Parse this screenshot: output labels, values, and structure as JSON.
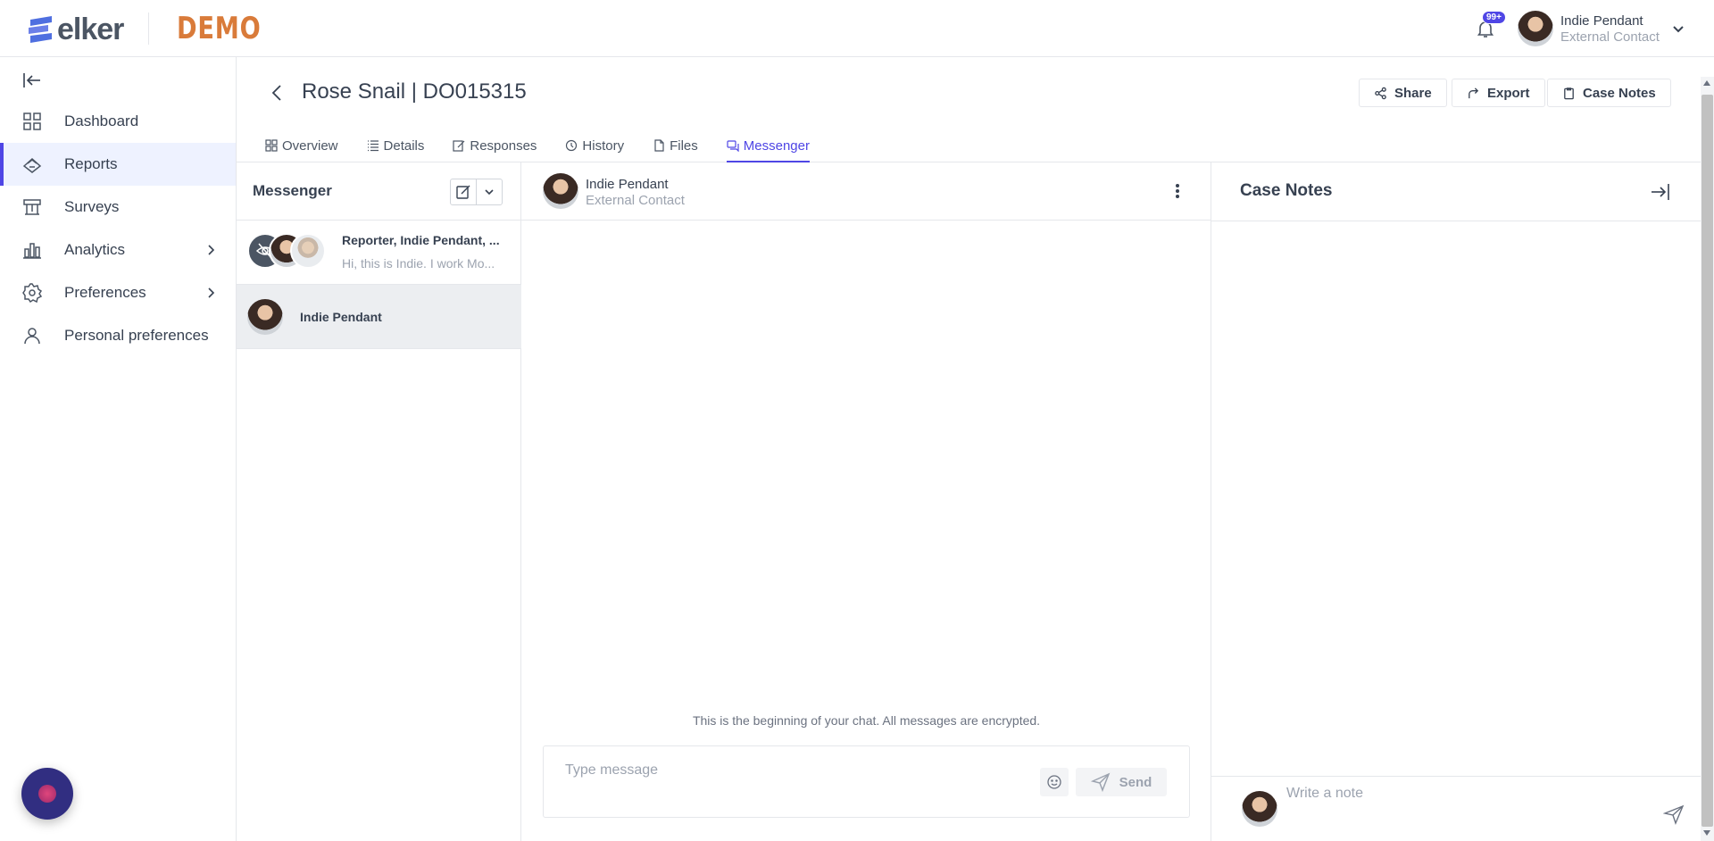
{
  "app": {
    "logo_text": "elker",
    "environment_label": "DEMO",
    "accent_color": "#4f46e5",
    "demo_color": "#d97b3a"
  },
  "topbar": {
    "notification_count": "99+",
    "user_name": "Indie Pendant",
    "user_role": "External Contact"
  },
  "sidebar": {
    "items": [
      {
        "label": "Dashboard",
        "icon": "grid-icon"
      },
      {
        "label": "Reports",
        "icon": "reports-icon",
        "active": true
      },
      {
        "label": "Surveys",
        "icon": "surveys-icon"
      },
      {
        "label": "Analytics",
        "icon": "bar-chart-icon",
        "has_submenu": true
      },
      {
        "label": "Preferences",
        "icon": "gear-icon",
        "has_submenu": true
      },
      {
        "label": "Personal preferences",
        "icon": "user-icon"
      }
    ]
  },
  "case": {
    "title": "Rose Snail | DO015315",
    "actions": {
      "share": "Share",
      "export": "Export",
      "case_notes": "Case Notes"
    },
    "tabs": [
      {
        "label": "Overview"
      },
      {
        "label": "Details"
      },
      {
        "label": "Responses"
      },
      {
        "label": "History"
      },
      {
        "label": "Files"
      },
      {
        "label": "Messenger",
        "active": true
      }
    ]
  },
  "messenger": {
    "title": "Messenger",
    "conversations": [
      {
        "name": "Reporter, Indie Pendant, ...",
        "preview": "Hi, this is Indie. I work Mo..."
      },
      {
        "name": "Indie Pendant",
        "selected": true
      }
    ]
  },
  "chat": {
    "contact_name": "Indie Pendant",
    "contact_role": "External Contact",
    "notice": "This is the beginning of your chat. All messages are encrypted.",
    "input_placeholder": "Type message",
    "send_label": "Send"
  },
  "notes": {
    "title": "Case Notes",
    "input_placeholder": "Write a note"
  }
}
